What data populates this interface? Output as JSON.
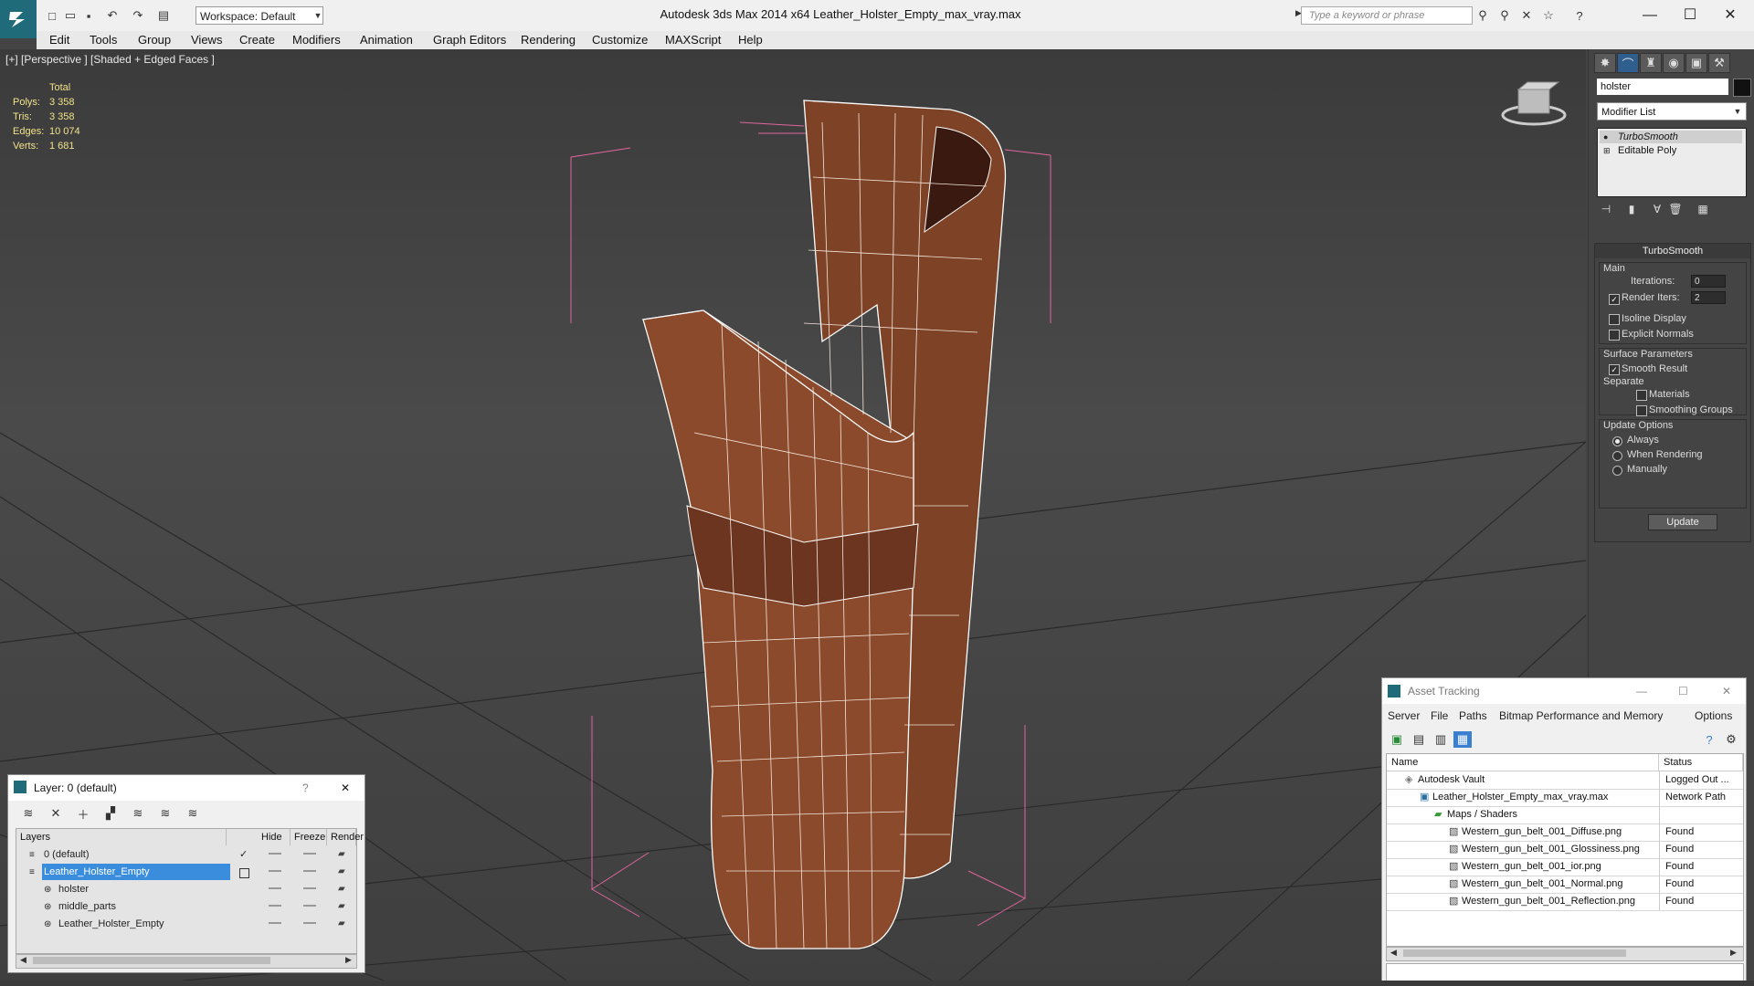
{
  "app": {
    "window_title": "Autodesk 3ds Max  2014 x64       Leather_Holster_Empty_max_vray.max",
    "workspace": "Workspace: Default",
    "search_placeholder": "Type a keyword or phrase",
    "minimize": "—",
    "maximize": "☐",
    "close": "✕"
  },
  "menu": [
    "Edit",
    "Tools",
    "Group",
    "Views",
    "Create",
    "Modifiers",
    "Animation",
    "Graph Editors",
    "Rendering",
    "Customize",
    "MAXScript",
    "Help"
  ],
  "viewport": {
    "label": "[+] [Perspective ] [Shaded + Edged Faces ]",
    "stats": {
      "header": "Total",
      "rows": [
        {
          "label": "Polys:",
          "value": "3 358"
        },
        {
          "label": "Tris:",
          "value": "3 358"
        },
        {
          "label": "Edges:",
          "value": "10 074"
        },
        {
          "label": "Verts:",
          "value": "1 681"
        }
      ]
    },
    "model_color": "#8a4628"
  },
  "command_panel": {
    "object_name": "holster",
    "modifier_list": "Modifier List",
    "stack": [
      "TurboSmooth",
      "Editable Poly"
    ],
    "rollout_title": "TurboSmooth",
    "main_group": "Main",
    "iterations_label": "Iterations:",
    "iterations_value": "0",
    "render_iters_label": "Render Iters:",
    "render_iters_value": "2",
    "isoline": "Isoline Display",
    "explicit_normals": "Explicit Normals",
    "surface_group": "Surface Parameters",
    "smooth_result": "Smooth Result",
    "separate": "Separate",
    "materials": "Materials",
    "smoothing_groups": "Smoothing Groups",
    "update_group": "Update Options",
    "always": "Always",
    "when_rendering": "When Rendering",
    "manually": "Manually",
    "update_button": "Update"
  },
  "layer_dialog": {
    "title": "Layer: 0 (default)",
    "help": "?",
    "close": "✕",
    "columns": [
      "Layers",
      "Hide",
      "Freeze",
      "Render"
    ],
    "rows": [
      {
        "name": "0 (default)",
        "indent": 0,
        "selected": false,
        "check": true
      },
      {
        "name": "Leather_Holster_Empty",
        "indent": 0,
        "selected": true,
        "check": false
      },
      {
        "name": "holster",
        "indent": 1,
        "selected": false,
        "check": false
      },
      {
        "name": "middle_parts",
        "indent": 1,
        "selected": false,
        "check": false
      },
      {
        "name": "Leather_Holster_Empty",
        "indent": 1,
        "selected": false,
        "check": false
      }
    ]
  },
  "asset_dialog": {
    "title": "Asset Tracking",
    "menu": [
      "Server",
      "File",
      "Paths",
      "Bitmap Performance and Memory",
      "Options"
    ],
    "columns": [
      "Name",
      "Status"
    ],
    "rows": [
      {
        "name": "Autodesk Vault",
        "status": "Logged Out ...",
        "indent": 1
      },
      {
        "name": "Leather_Holster_Empty_max_vray.max",
        "status": "Network Path",
        "indent": 2
      },
      {
        "name": "Maps / Shaders",
        "status": "",
        "indent": 3
      },
      {
        "name": "Western_gun_belt_001_Diffuse.png",
        "status": "Found",
        "indent": 4
      },
      {
        "name": "Western_gun_belt_001_Glossiness.png",
        "status": "Found",
        "indent": 4
      },
      {
        "name": "Western_gun_belt_001_ior.png",
        "status": "Found",
        "indent": 4
      },
      {
        "name": "Western_gun_belt_001_Normal.png",
        "status": "Found",
        "indent": 4
      },
      {
        "name": "Western_gun_belt_001_Reflection.png",
        "status": "Found",
        "indent": 4
      }
    ]
  }
}
